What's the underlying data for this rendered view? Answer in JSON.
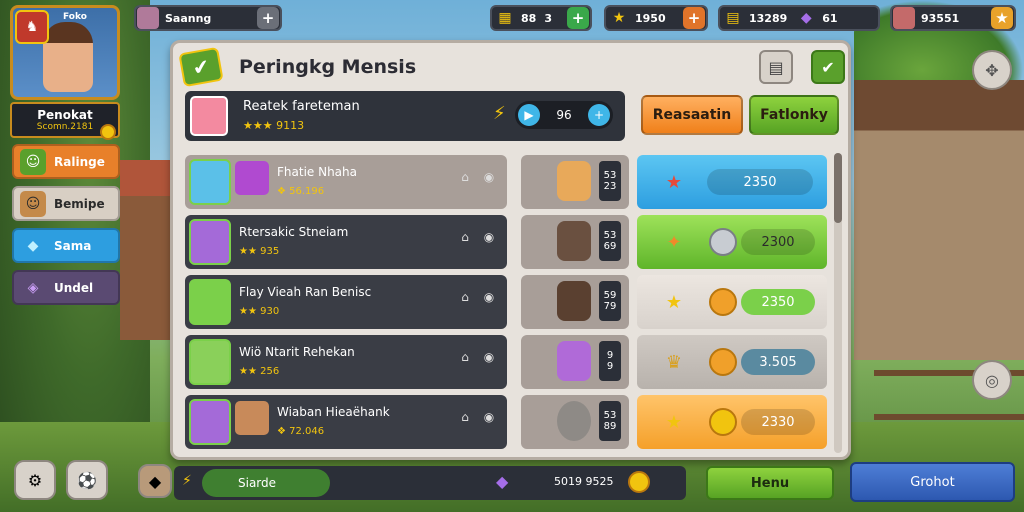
{
  "profile": {
    "tag": "Foko",
    "name": "Penokat",
    "sub": "Scomn.2181"
  },
  "topbar": {
    "player_name": "Saanng",
    "currency1": "88",
    "currency1_b": "3",
    "currency2": "1950",
    "currency3": "13289",
    "currency3_b": "61",
    "currency4": "93551"
  },
  "sidemenu": {
    "items": [
      {
        "label": "Ralinge",
        "color": "#e8802a"
      },
      {
        "label": "Bemipe",
        "color": "#d8cfc4"
      },
      {
        "label": "Sama",
        "color": "#2d9ee0"
      },
      {
        "label": "Undel",
        "color": "#5a4a72"
      }
    ]
  },
  "panel": {
    "title": "Peringkg Mensis",
    "info_title": "Reatek fareteman",
    "info_stars": "★★★ 9113",
    "counter_value": "96",
    "btn_orange": "Reasaatin",
    "btn_green": "Fatlonky"
  },
  "rows": [
    {
      "name": "Fhatie Nhaha",
      "sub": "❖ 56.196",
      "score_top": "53",
      "score_bot": "23",
      "value": "2350",
      "bg": "#3fb6e8",
      "icon": "★"
    },
    {
      "name": "Rtersakic Stneiam",
      "sub": "★★ 935",
      "score_top": "53",
      "score_bot": "69",
      "value": "2300",
      "bg": "#7bd04a",
      "icon": "✦"
    },
    {
      "name": "Flay Vieah Ran Benisc",
      "sub": "★★ 930",
      "score_top": "59",
      "score_bot": "79",
      "value": "2350",
      "bg": "#e8e2dc",
      "icon": "★"
    },
    {
      "name": "Wiö Ntarit Rehekan",
      "sub": "★★ 256",
      "score_top": "9",
      "score_bot": "9",
      "value": "3.505",
      "bg": "#c8c2bc",
      "icon": "♛"
    },
    {
      "name": "Wiaban Hieaëhank",
      "sub": "❖ 72.046",
      "score_top": "53",
      "score_bot": "89",
      "value": "2330",
      "bg": "#f5b04a",
      "icon": "★"
    }
  ],
  "bottom": {
    "green_pill": "Siarde",
    "score": "5019 9525",
    "green_btn": "Henu",
    "blue_btn": "Grohot"
  }
}
